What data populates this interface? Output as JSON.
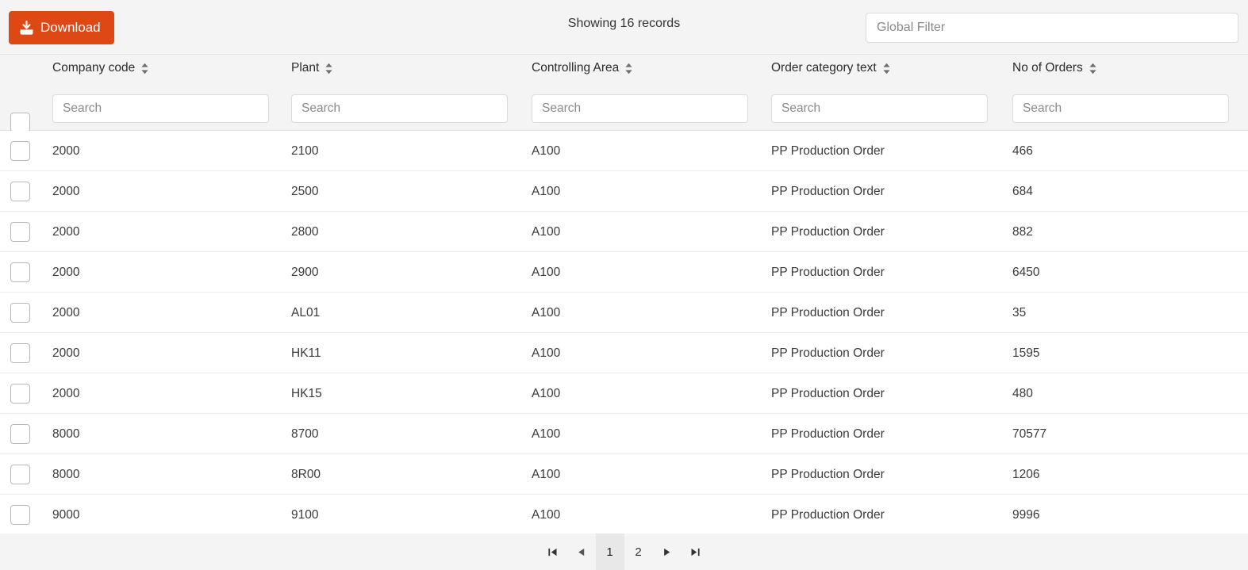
{
  "toolbar": {
    "download_label": "Download",
    "download_icon": "download-icon",
    "download_color": "#dd4814",
    "records_text": "Showing 16 records",
    "global_filter_placeholder": "Global Filter",
    "global_filter_value": ""
  },
  "table": {
    "select_all_checked": false,
    "sort_icon": "sort-updown-icon",
    "columns": [
      {
        "label": "Company code",
        "search_placeholder": "Search",
        "search_value": "",
        "sortable": true
      },
      {
        "label": "Plant",
        "search_placeholder": "Search",
        "search_value": "",
        "sortable": true
      },
      {
        "label": "Controlling Area",
        "search_placeholder": "Search",
        "search_value": "",
        "sortable": true
      },
      {
        "label": "Order category text",
        "search_placeholder": "Search",
        "search_value": "",
        "sortable": true
      },
      {
        "label": "No of Orders",
        "search_placeholder": "Search",
        "search_value": "",
        "sortable": true
      }
    ],
    "rows": [
      {
        "company_code": "2000",
        "plant": "2100",
        "controlling_area": "A100",
        "order_category_text": "PP Production Order",
        "no_of_orders": "466"
      },
      {
        "company_code": "2000",
        "plant": "2500",
        "controlling_area": "A100",
        "order_category_text": "PP Production Order",
        "no_of_orders": "684"
      },
      {
        "company_code": "2000",
        "plant": "2800",
        "controlling_area": "A100",
        "order_category_text": "PP Production Order",
        "no_of_orders": "882"
      },
      {
        "company_code": "2000",
        "plant": "2900",
        "controlling_area": "A100",
        "order_category_text": "PP Production Order",
        "no_of_orders": "6450"
      },
      {
        "company_code": "2000",
        "plant": "AL01",
        "controlling_area": "A100",
        "order_category_text": "PP Production Order",
        "no_of_orders": "35"
      },
      {
        "company_code": "2000",
        "plant": "HK11",
        "controlling_area": "A100",
        "order_category_text": "PP Production Order",
        "no_of_orders": "1595"
      },
      {
        "company_code": "2000",
        "plant": "HK15",
        "controlling_area": "A100",
        "order_category_text": "PP Production Order",
        "no_of_orders": "480"
      },
      {
        "company_code": "8000",
        "plant": "8700",
        "controlling_area": "A100",
        "order_category_text": "PP Production Order",
        "no_of_orders": "70577"
      },
      {
        "company_code": "8000",
        "plant": "8R00",
        "controlling_area": "A100",
        "order_category_text": "PP Production Order",
        "no_of_orders": "1206"
      },
      {
        "company_code": "9000",
        "plant": "9100",
        "controlling_area": "A100",
        "order_category_text": "PP Production Order",
        "no_of_orders": "9996"
      }
    ]
  },
  "pagination": {
    "first_icon": "first-page-icon",
    "prev_icon": "prev-page-icon",
    "next_icon": "next-page-icon",
    "last_icon": "last-page-icon",
    "pages": [
      "1",
      "2"
    ],
    "active_page": "1",
    "active_bg": "#e8e8e8"
  }
}
